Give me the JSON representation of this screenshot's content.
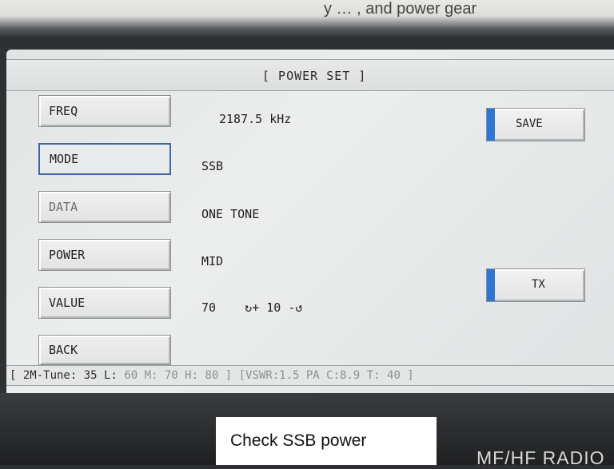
{
  "top_caption_fragment": "y …  , and power gear",
  "screen": {
    "title": "[ POWER SET ]",
    "menu": [
      {
        "label": "FREQ",
        "value": "2187.5 kHz"
      },
      {
        "label": "MODE",
        "value": "SSB"
      },
      {
        "label": "DATA",
        "value": "ONE TONE"
      },
      {
        "label": "POWER",
        "value": "MID"
      },
      {
        "label": "VALUE",
        "value": "70    ↻+ 10 -↺"
      },
      {
        "label": "BACK",
        "value": ""
      }
    ],
    "side_buttons": {
      "save": "SAVE",
      "tx": "TX"
    },
    "status": {
      "prefix": "[ 2M-Tune: 35 L: ",
      "rest": "60 M: 70 H: 80 ] [VSWR:1.5 PA C:8.9 T: 40 ]"
    },
    "colors": {
      "accent": "#2f76d2",
      "active_border": "#3c66a8"
    }
  },
  "caption": "Check SSB power",
  "brand": "MF/HF RADIO"
}
